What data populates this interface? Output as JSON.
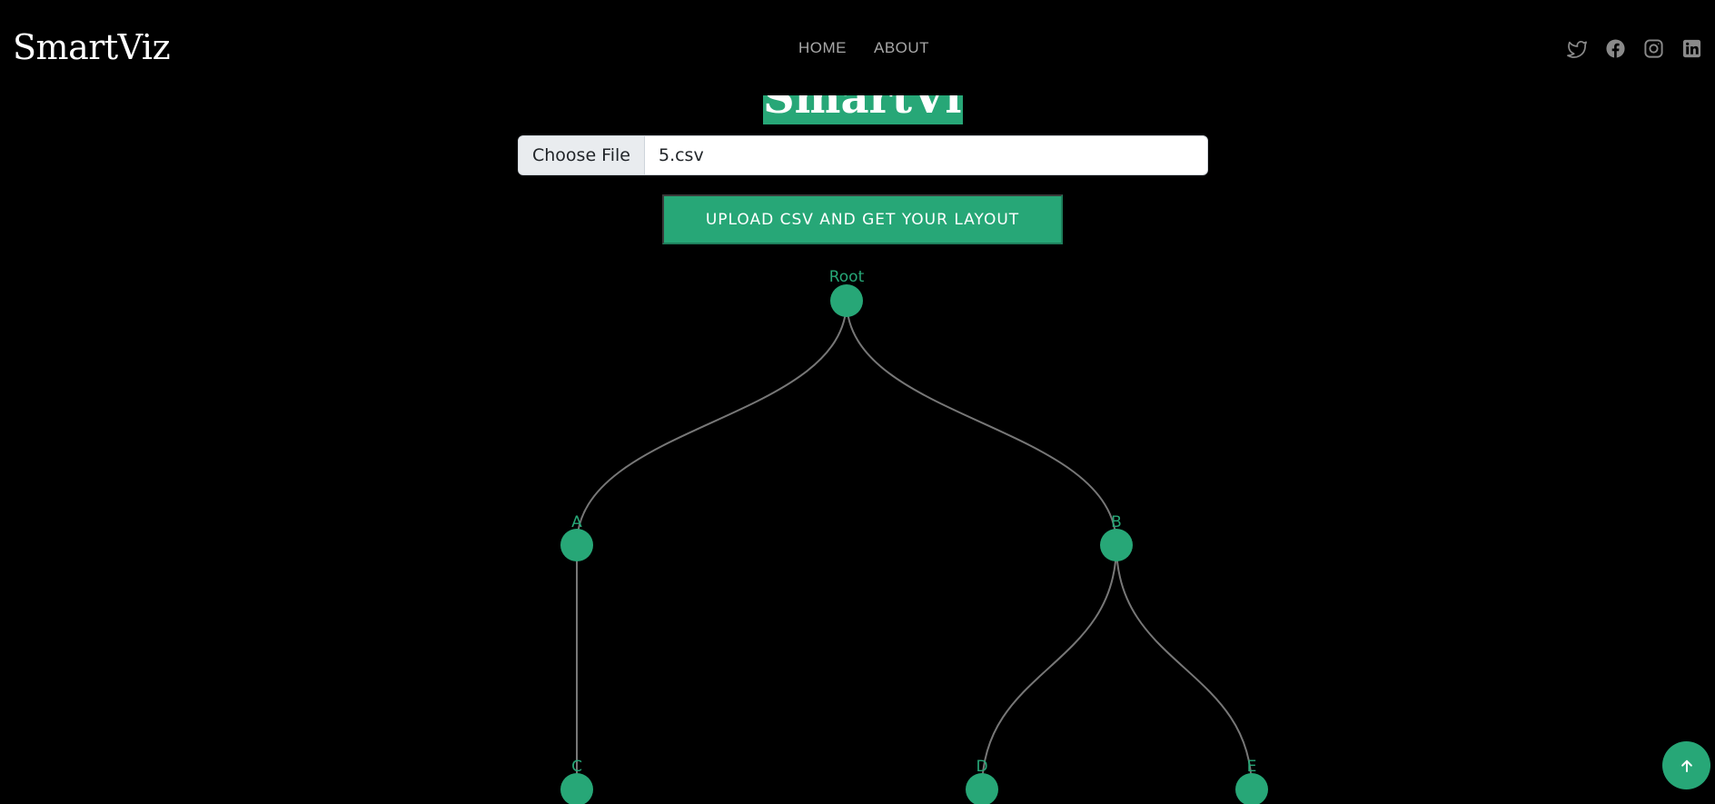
{
  "brand": "SmartViz",
  "nav": {
    "home": "HOME",
    "about": "ABOUT"
  },
  "socials": [
    "twitter-icon",
    "facebook-icon",
    "instagram-icon",
    "linkedin-icon"
  ],
  "hero": {
    "title": "SmartViz."
  },
  "upload": {
    "choose_label": "Choose File",
    "file_name": "5.csv",
    "submit_label": "UPLOAD CSV AND GET YOUR LAYOUT"
  },
  "tree": {
    "root": "Root",
    "children": [
      {
        "name": "A",
        "children": [
          {
            "name": "C"
          }
        ]
      },
      {
        "name": "B",
        "children": [
          {
            "name": "D"
          },
          {
            "name": "E"
          }
        ]
      }
    ]
  },
  "colors": {
    "accent": "#27a777",
    "background": "#000000",
    "link": "#777777"
  },
  "scroll_top_icon": "arrow-up-icon"
}
